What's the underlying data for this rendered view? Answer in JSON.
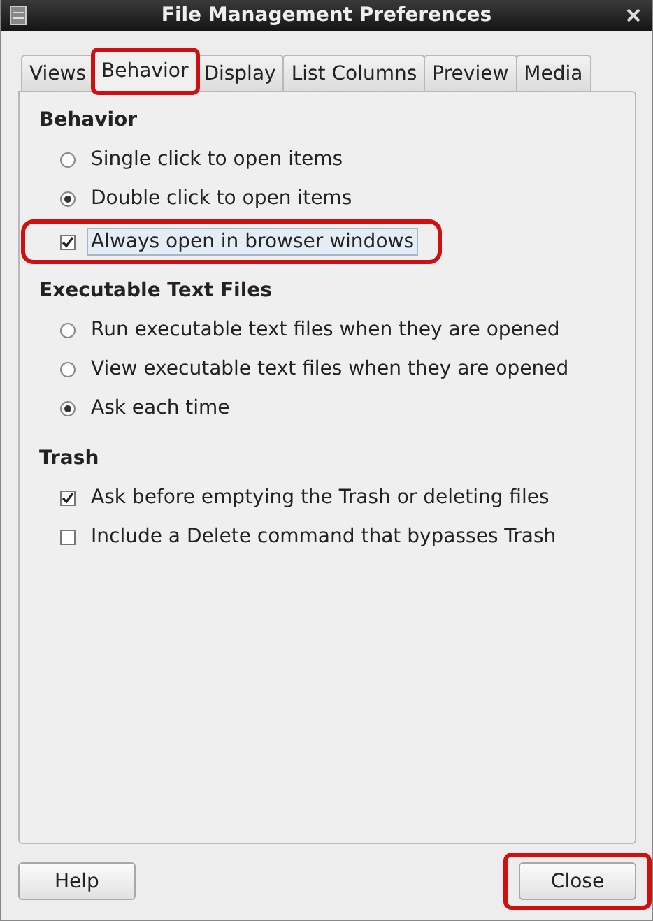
{
  "window": {
    "title": "File Management Preferences"
  },
  "tabs": [
    {
      "label": "Views",
      "selected": false,
      "highlighted": false
    },
    {
      "label": "Behavior",
      "selected": true,
      "highlighted": true
    },
    {
      "label": "Display",
      "selected": false,
      "highlighted": false
    },
    {
      "label": "List Columns",
      "selected": false,
      "highlighted": false
    },
    {
      "label": "Preview",
      "selected": false,
      "highlighted": false
    },
    {
      "label": "Media",
      "selected": false,
      "highlighted": false
    }
  ],
  "sections": [
    {
      "heading": "Behavior",
      "options": [
        {
          "kind": "radio",
          "label": "Single click to open items",
          "selected": false,
          "focused": false,
          "highlighted": false
        },
        {
          "kind": "radio",
          "label": "Double click to open items",
          "selected": true,
          "focused": false,
          "highlighted": false
        },
        {
          "kind": "checkbox",
          "label": "Always open in browser windows",
          "checked": true,
          "focused": true,
          "highlighted": true
        }
      ]
    },
    {
      "heading": "Executable Text Files",
      "options": [
        {
          "kind": "radio",
          "label": "Run executable text files when they are opened",
          "selected": false,
          "focused": false,
          "highlighted": false
        },
        {
          "kind": "radio",
          "label": "View executable text files when they are opened",
          "selected": false,
          "focused": false,
          "highlighted": false
        },
        {
          "kind": "radio",
          "label": "Ask each time",
          "selected": true,
          "focused": false,
          "highlighted": false
        }
      ]
    },
    {
      "heading": "Trash",
      "options": [
        {
          "kind": "checkbox",
          "label": "Ask before emptying the Trash or deleting files",
          "checked": true,
          "focused": false,
          "highlighted": false
        },
        {
          "kind": "checkbox",
          "label": "Include a Delete command that bypasses Trash",
          "checked": false,
          "focused": false,
          "highlighted": false
        }
      ]
    }
  ],
  "buttons": [
    {
      "label": "Help",
      "highlighted": false
    },
    {
      "label": "Close",
      "highlighted": true
    }
  ]
}
